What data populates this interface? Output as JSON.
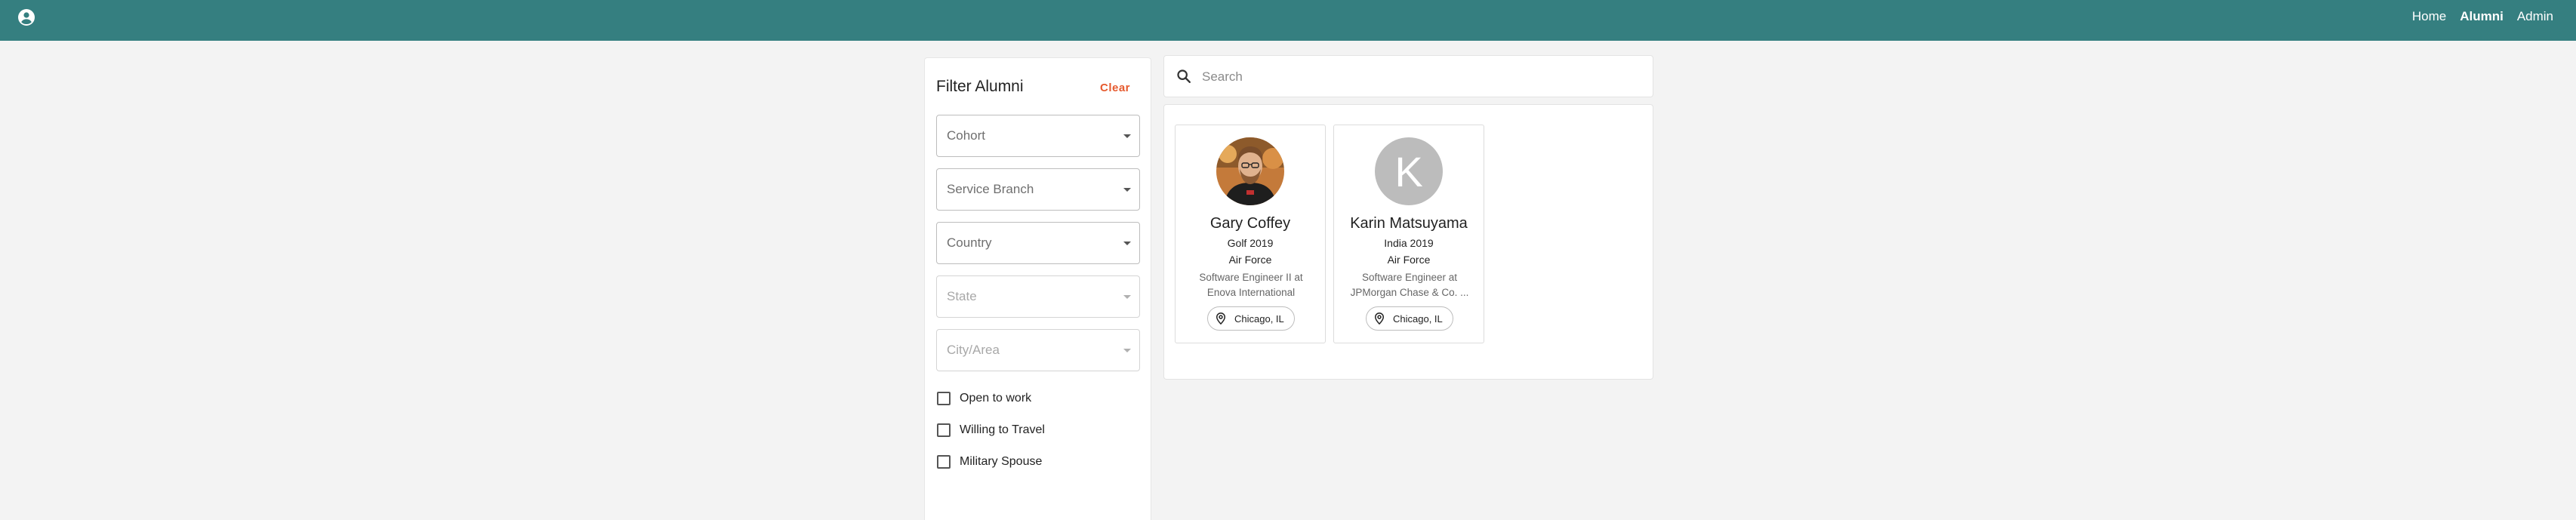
{
  "nav": {
    "account_icon": "account-circle-icon",
    "links": [
      "Home",
      "Alumni",
      "Admin"
    ],
    "active": "Alumni"
  },
  "filters": {
    "title": "Filter Alumni",
    "clear_label": "Clear",
    "selects": [
      {
        "label": "Cohort",
        "disabled": false
      },
      {
        "label": "Service Branch",
        "disabled": false
      },
      {
        "label": "Country",
        "disabled": false
      },
      {
        "label": "State",
        "disabled": true
      },
      {
        "label": "City/Area",
        "disabled": true
      }
    ],
    "checkboxes": [
      {
        "label": "Open to work",
        "checked": false
      },
      {
        "label": "Willing to Travel",
        "checked": false
      },
      {
        "label": "Military Spouse",
        "checked": false
      }
    ]
  },
  "search": {
    "placeholder": "Search",
    "value": "",
    "icon": "search-icon"
  },
  "alumni": [
    {
      "name": "Gary Coffey",
      "cohort": "Golf 2019",
      "branch": "Air Force",
      "job_line1": "Software Engineer II at",
      "job_line2": "Enova International",
      "location": "Chicago, IL",
      "avatar": "photo"
    },
    {
      "name": "Karin Matsuyama",
      "cohort": "India 2019",
      "branch": "Air Force",
      "job_line1": "Software Engineer at",
      "job_line2": "JPMorgan Chase & Co. ...",
      "location": "Chicago, IL",
      "avatar_letter": "K"
    }
  ],
  "colors": {
    "header": "#357f80",
    "accent": "#e65a2e",
    "background": "#f3f3f3"
  }
}
